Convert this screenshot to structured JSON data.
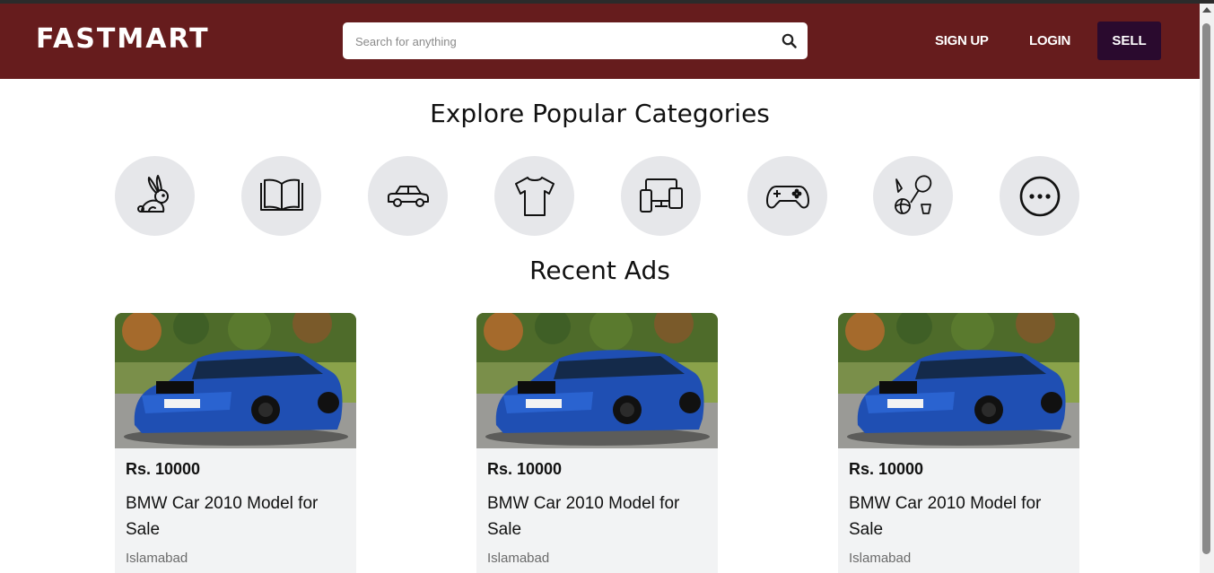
{
  "header": {
    "brand": "FASTMART",
    "search_placeholder": "Search for anything",
    "search_value": "",
    "signup_label": "SIGN UP",
    "login_label": "LOGIN",
    "sell_label": "SELL"
  },
  "categories": {
    "title": "Explore Popular Categories",
    "items": [
      {
        "icon": "rabbit-icon"
      },
      {
        "icon": "book-icon"
      },
      {
        "icon": "car-icon"
      },
      {
        "icon": "tshirt-icon"
      },
      {
        "icon": "devices-icon"
      },
      {
        "icon": "gamepad-icon"
      },
      {
        "icon": "sports-icon"
      },
      {
        "icon": "more-icon"
      }
    ]
  },
  "recent_ads": {
    "title": "Recent Ads",
    "items": [
      {
        "price": "Rs. 10000",
        "title": "BMW Car 2010 Model for Sale",
        "city": "Islamabad"
      },
      {
        "price": "Rs. 10000",
        "title": "BMW Car 2010 Model for Sale",
        "city": "Islamabad"
      },
      {
        "price": "Rs. 10000",
        "title": "BMW Car 2010 Model for Sale",
        "city": "Islamabad"
      }
    ]
  },
  "colors": {
    "header_bg": "#661c1d",
    "sell_bg": "#2a0a2e",
    "category_bg": "#e6e7ea",
    "card_bg": "#f2f3f4"
  }
}
